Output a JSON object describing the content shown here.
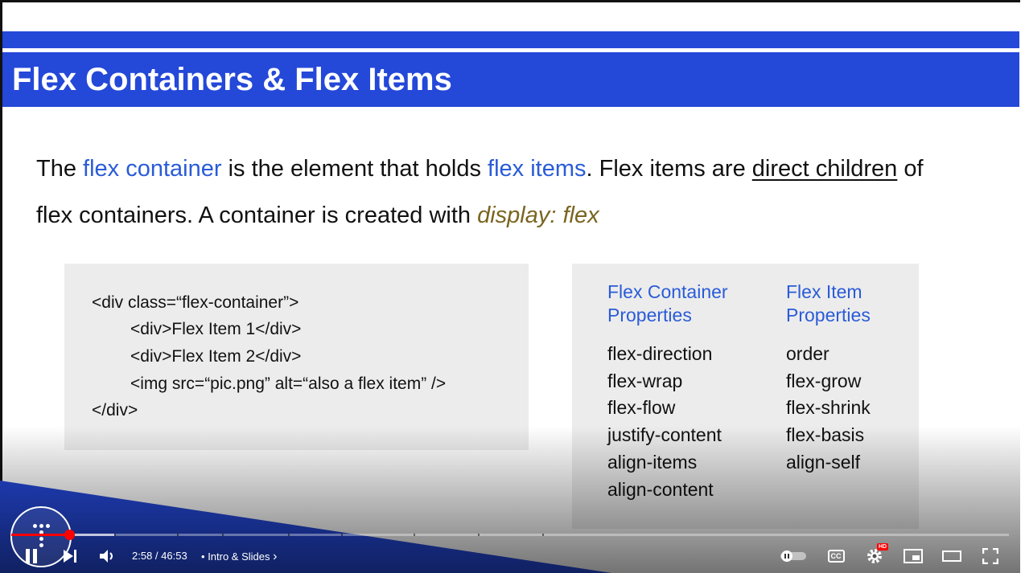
{
  "slide": {
    "title": "Flex Containers & Flex Items",
    "lead": {
      "part1": "The ",
      "term1": "flex container",
      "part2": " is the element that holds ",
      "term2": "flex items",
      "part3": ". Flex items are ",
      "underlined": "direct children",
      "part4": " of flex containers. A container is created with ",
      "code": "display: flex"
    },
    "code_lines": [
      "<div class=“flex-container”>",
      "<div>Flex Item 1</div>",
      "<div>Flex Item 2</div>",
      "<img src=“pic.png” alt=“also a flex item” />",
      "</div>"
    ],
    "container_props": {
      "heading_line1": "Flex Container",
      "heading_line2": "Properties",
      "items": [
        "flex-direction",
        "flex-wrap",
        "flex-flow",
        "justify-content",
        "align-items",
        "align-content"
      ]
    },
    "item_props": {
      "heading_line1": "Flex Item",
      "heading_line2": "Properties",
      "items": [
        "order",
        "flex-grow",
        "flex-shrink",
        "flex-basis",
        "align-self"
      ]
    }
  },
  "player": {
    "time": "2:58 / 46:53",
    "separator": "•",
    "chapter": "Intro & Slides",
    "chapter_chevron": "›",
    "hd_badge": "HD",
    "cc_label": "CC",
    "progress_played_fraction": 0.058,
    "progress_buffered_fraction": 0.103,
    "icons": [
      "pause-icon",
      "next-icon",
      "volume-icon",
      "autoplay-toggle-icon",
      "captions-icon",
      "settings-icon",
      "miniplayer-icon",
      "theater-icon",
      "fullscreen-icon"
    ]
  },
  "colors": {
    "brand_blue": "#2448d8",
    "term_blue": "#2a5bd7",
    "code_olive": "#7a6520",
    "progress_red": "#ff0000"
  }
}
